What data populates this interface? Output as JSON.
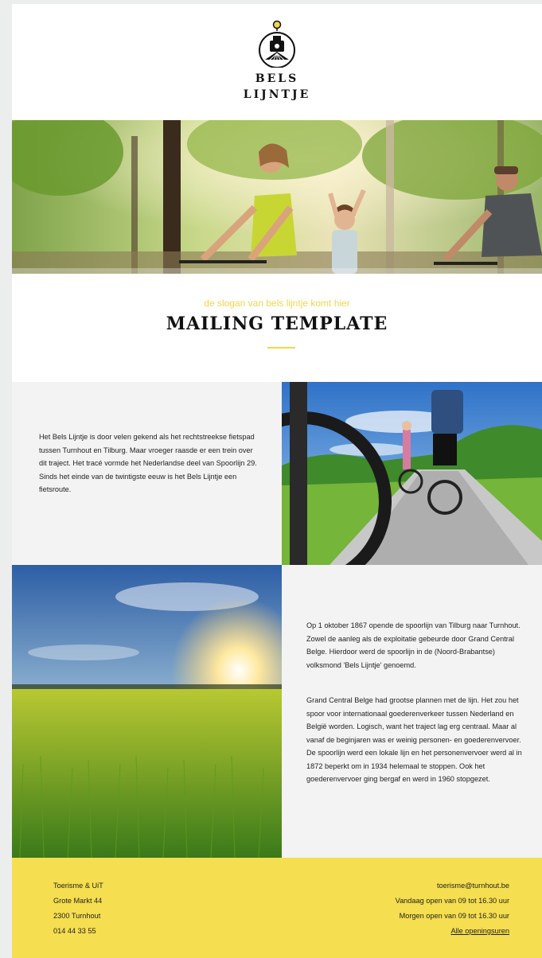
{
  "header": {
    "logo_line1": "BELS",
    "logo_line2": "LIJNTJE"
  },
  "hero": {
    "image": "family-cycling-photo"
  },
  "intro": {
    "slogan": "de slogan van bels lijntje komt hier",
    "title": "MAILING TEMPLATE"
  },
  "content": {
    "paragraph1": "Het Bels Lijntje is door velen gekend als het rechtstreekse fietspad tussen Turnhout en Tilburg. Maar vroeger raasde er een trein over dit traject. Het tracé vormde het Nederlandse deel van Spoorlijn 29. Sinds het einde van de twintigste eeuw is het Bels Lijntje een fietsroute.",
    "image1": "cyclists-on-path-photo",
    "image2": "sunset-field-photo",
    "paragraph2": "Op 1 oktober 1867 opende de spoorlijn van Tilburg naar Turnhout. Zowel de aanleg als de exploitatie gebeurde door Grand Central Belge. Hierdoor werd de spoorlijn in de (Noord-Brabantse) volksmond 'Bels Lijntje' genoemd.",
    "paragraph3": "Grand Central Belge had grootse plannen met de lijn. Het zou het spoor voor internationaal goederenverkeer tussen Nederland en België worden. Logisch, want het traject lag erg centraal. Maar al vanaf de beginjaren was er weinig personen- en goederenvervoer. De spoorlijn werd een lokale lijn en het personenvervoer werd al in 1872 beperkt om in 1934 helemaal te stoppen. Ook het goederenvervoer ging bergaf en werd in 1960 stopgezet."
  },
  "footer": {
    "org": "Toerisme & UiT",
    "street": "Grote Markt 44",
    "city": "2300 Turnhout",
    "phone": "014 44 33 55",
    "email": "toerisme@turnhout.be",
    "today": "Vandaag open van 09 tot 16.30 uur",
    "tomorrow": "Morgen open van 09 tot 16.30 uur",
    "hours_link": "Alle openingsuren"
  },
  "colors": {
    "accent": "#f2d64b",
    "footer_bg": "#f5de4f",
    "panel_bg": "#f3f3f3",
    "page_bg": "#eceded"
  }
}
